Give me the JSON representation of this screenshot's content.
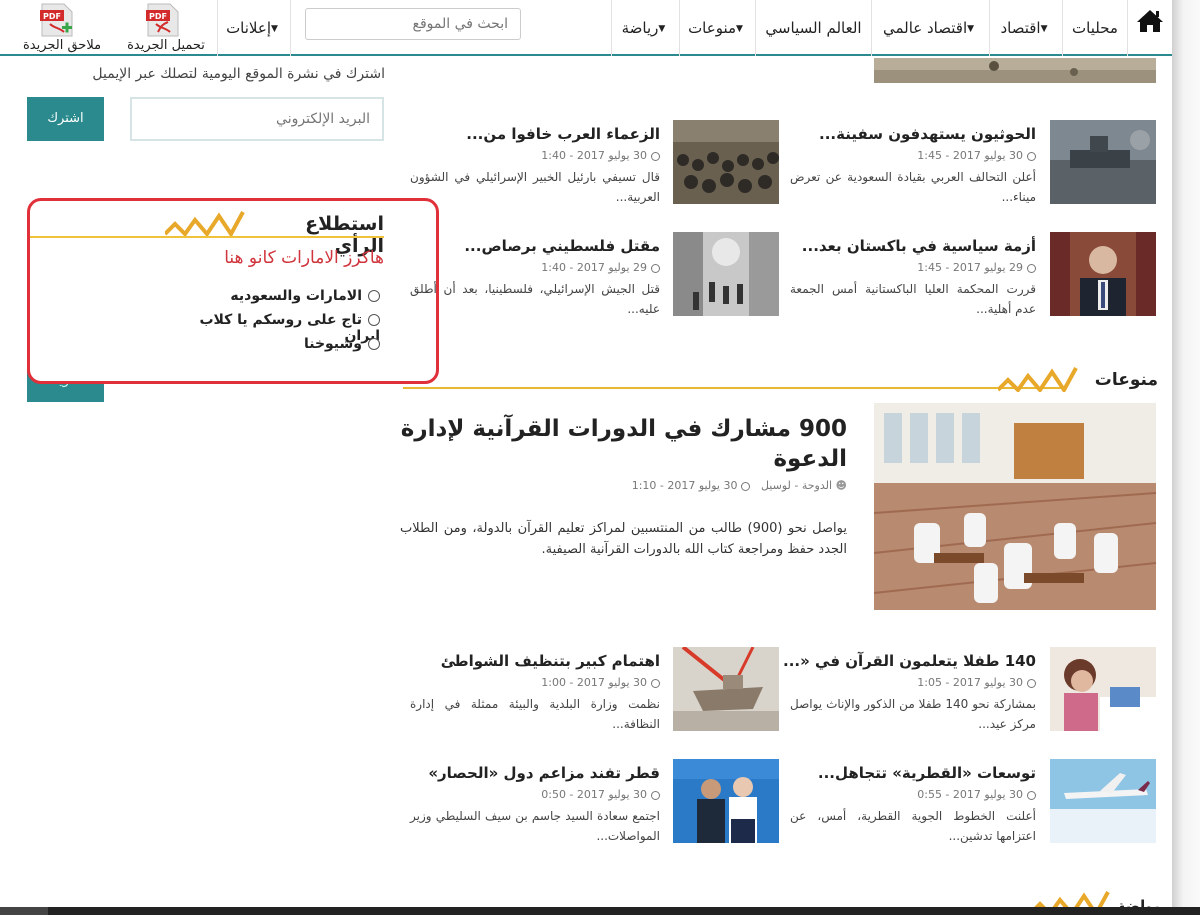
{
  "nav": {
    "home_icon": "home-icon",
    "items": [
      {
        "label": "محليات",
        "dropdown": false
      },
      {
        "label": "اقتصاد",
        "dropdown": true
      },
      {
        "label": "اقتصاد عالمي",
        "dropdown": true
      },
      {
        "label": "العالم السياسي",
        "dropdown": false
      },
      {
        "label": "منوعات",
        "dropdown": true
      },
      {
        "label": "رياضة",
        "dropdown": true
      },
      {
        "label": "إعلانات",
        "dropdown": true
      }
    ],
    "search_placeholder": "ابحث في الموقع",
    "pdf_buttons": [
      {
        "label": "تحميل الجريدة",
        "icon": "pdf-icon"
      },
      {
        "label": "ملاحق الجريدة",
        "icon": "pdf-plus-icon"
      }
    ],
    "accent_color": "#2a8a8e"
  },
  "newsletter": {
    "text": "اشترك في نشرة الموقع اليومية لتصلك عبر الإيميل",
    "email_placeholder": "البريد الإلكتروني",
    "subscribe_label": "اشترك"
  },
  "poll": {
    "title": "استطلاع الرأي",
    "question": "هاكرز الامارات كانو هنا",
    "options": [
      "الامارات والسعوديه",
      "تاج على روسكم يا كلاب ايران",
      "وشيوخنا"
    ],
    "vote_label": "تصويت",
    "highlight_color": "#e0303a"
  },
  "news_top": [
    {
      "title": "الحوثيون يستهدفون سفينة...",
      "time": "30 يوليو 2017 - 1:45",
      "excerpt": "أعلن التحالف العربي بقيادة السعودية عن تعرض ميناء..."
    },
    {
      "title": "الزعماء العرب خافوا من...",
      "time": "30 يوليو 2017 - 1:40",
      "excerpt": "قال تسيفي بارئيل الخبير الإسرائيلي في الشؤون العربية..."
    },
    {
      "title": "أزمة سياسية في باكستان بعد...",
      "time": "29 يوليو 2017 - 1:45",
      "excerpt": "قررت المحكمة العليا الباكستانية أمس الجمعة عدم أهلية..."
    },
    {
      "title": "مقتل فلسطيني برصاص...",
      "time": "29 يوليو 2017 - 1:40",
      "excerpt": "قتل الجيش الإسرائيلي، فلسطينيا، بعد أن أطلق عليه..."
    }
  ],
  "section": {
    "title": "منوعات"
  },
  "featured": {
    "title": "900 مشارك في الدورات القرآنية لإدارة الدعوة",
    "author": "الدوحة - لوسيل",
    "time": "30 يوليو 2017 - 1:10",
    "excerpt": "يواصل نحو (900) طالب من المنتسبين لمراكز تعليم القرآن بالدولة، ومن الطلاب الجدد حفظ ومراجعة كتاب الله بالدورات القرآنية الصيفية."
  },
  "news_bottom": [
    {
      "title": "140 طفلا يتعلمون القرآن في «...",
      "time": "30 يوليو 2017 - 1:05",
      "excerpt": "بمشاركة نحو 140 طفلا من الذكور والإناث يواصل مركز عيد..."
    },
    {
      "title": "اهتمام كبير بتنظيف الشواطئ",
      "time": "30 يوليو 2017 - 1:00",
      "excerpt": "نظمت وزارة البلدية والبيئة ممثلة في إدارة النظافة..."
    },
    {
      "title": "توسعات «القطرية» تتجاهل...",
      "time": "30 يوليو 2017 - 0:55",
      "excerpt": "أعلنت الخطوط الجوية القطرية، أمس، عن اعتزامها تدشين..."
    },
    {
      "title": "قطر تفند مزاعم دول «الحصار»",
      "time": "30 يوليو 2017 - 0:50",
      "excerpt": "اجتمع سعادة السيد جاسم بن سيف السليطي وزير المواصلات..."
    }
  ],
  "next_section": {
    "title": "رياضة"
  }
}
